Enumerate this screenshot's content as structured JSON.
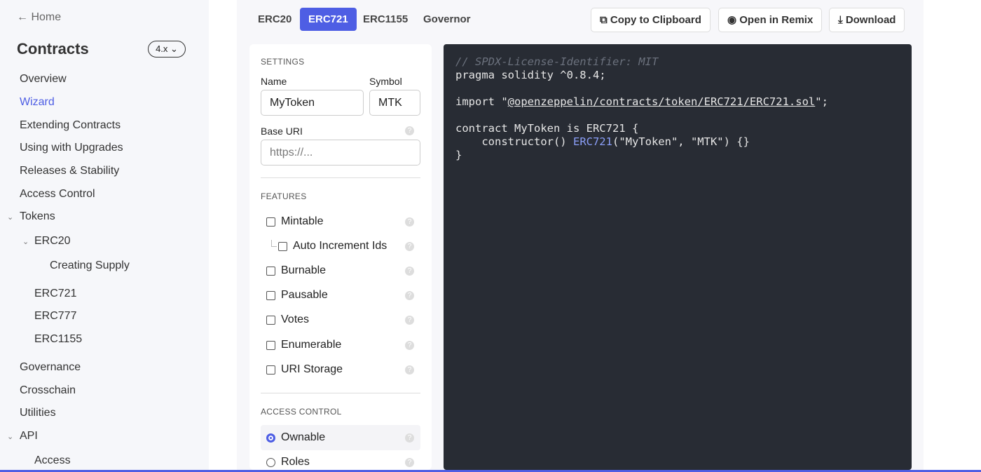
{
  "sidebar": {
    "home": "← Home",
    "title": "Contracts",
    "version": "4.x",
    "items": [
      "Overview",
      "Wizard",
      "Extending Contracts",
      "Using with Upgrades",
      "Releases & Stability",
      "Access Control",
      "Tokens",
      "ERC20",
      "Creating Supply",
      "ERC721",
      "ERC777",
      "ERC1155",
      "Governance",
      "Crosschain",
      "Utilities",
      "API",
      "Access"
    ]
  },
  "tabs": [
    "ERC20",
    "ERC721",
    "ERC1155",
    "Governor"
  ],
  "actions": {
    "copy": "Copy to Clipboard",
    "remix": "Open in Remix",
    "download": "Download"
  },
  "settings": {
    "heading": "SETTINGS",
    "name_label": "Name",
    "name_value": "MyToken",
    "symbol_label": "Symbol",
    "symbol_value": "MTK",
    "base_uri_label": "Base URI",
    "base_uri_placeholder": "https://..."
  },
  "features": {
    "heading": "FEATURES",
    "items": [
      "Mintable",
      "Auto Increment Ids",
      "Burnable",
      "Pausable",
      "Votes",
      "Enumerable",
      "URI Storage"
    ]
  },
  "access": {
    "heading": "ACCESS CONTROL",
    "items": [
      "Ownable",
      "Roles"
    ],
    "selected": "Ownable"
  },
  "code": {
    "l1": "// SPDX-License-Identifier: MIT",
    "l2": "pragma solidity ^0.8.4;",
    "l3a": "import \"",
    "l3b": "@openzeppelin/contracts/token/ERC721/ERC721.sol",
    "l3c": "\";",
    "l4": "contract MyToken is ERC721 {",
    "l5a": "    constructor() ",
    "l5b": "ERC721",
    "l5c": "(\"MyToken\", \"MTK\") {}",
    "l6": "}"
  }
}
